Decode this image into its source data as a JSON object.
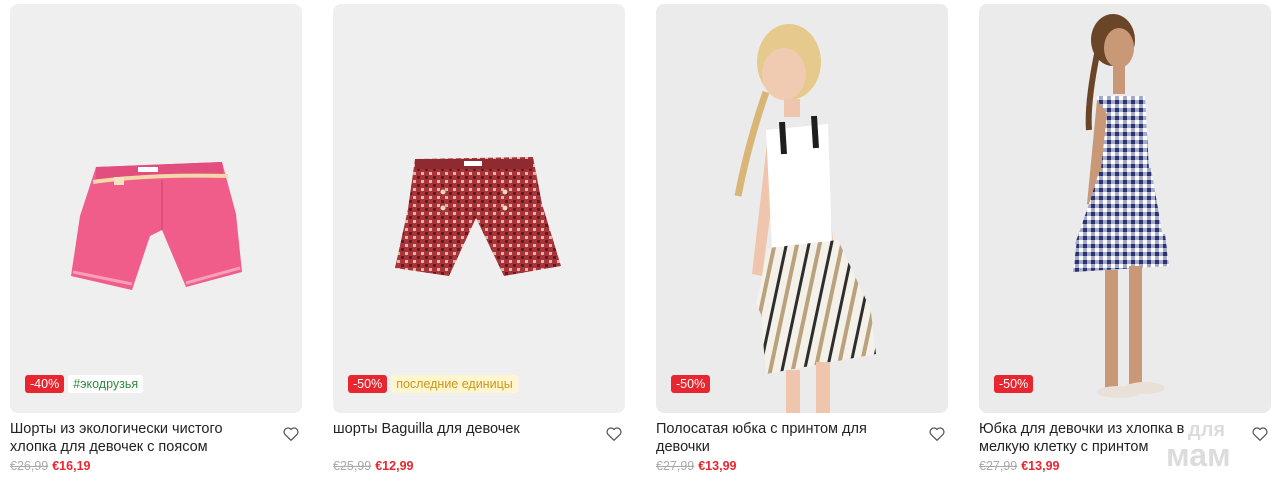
{
  "products": [
    {
      "title": "Шорты из экологически чистого хлопка для девочек с поясом",
      "discount": "-40%",
      "tag": "#экодрузья",
      "old_price": "€26,99",
      "price": "€16,19",
      "image": "pink-shorts"
    },
    {
      "title": "шорты Baguilla для девочек",
      "discount": "-50%",
      "tag": "последние единицы",
      "old_price": "€25,99",
      "price": "€12,99",
      "image": "red-tweed-shorts"
    },
    {
      "title": "Полосатая юбка с принтом для девочки",
      "discount": "-50%",
      "old_price": "€27,99",
      "price": "€13,99",
      "image": "girl-striped-skirt"
    },
    {
      "title": "Юбка для девочки из хлопка в мелкую клетку с принтом",
      "discount": "-50%",
      "old_price": "€27,99",
      "price": "€13,99",
      "image": "girl-gingham-skirt"
    }
  ],
  "icons": {
    "favorite": "heart-outline-icon"
  },
  "watermark": {
    "text_top": "для",
    "text_bottom": "мам"
  },
  "colors": {
    "sale": "#e8262f",
    "eco": "#2e8a3e",
    "last_units_bg": "#fff6cf",
    "last_units_text": "#c9971a",
    "old_price": "#a9a9a9"
  }
}
